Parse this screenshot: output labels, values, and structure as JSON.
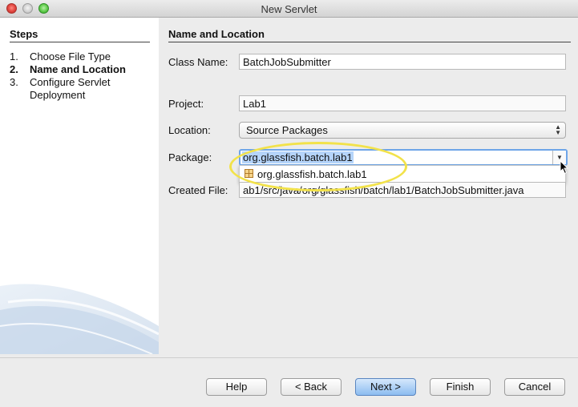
{
  "window": {
    "title": "New Servlet"
  },
  "steps": {
    "heading": "Steps",
    "items": [
      {
        "num": "1.",
        "label": "Choose File Type"
      },
      {
        "num": "2.",
        "label": "Name and Location"
      },
      {
        "num": "3.",
        "label": "Configure Servlet"
      },
      {
        "num": "",
        "label": "Deployment"
      }
    ]
  },
  "form": {
    "heading": "Name and Location",
    "class_name_label": "Class Name:",
    "class_name_value": "BatchJobSubmitter",
    "project_label": "Project:",
    "project_value": "Lab1",
    "location_label": "Location:",
    "location_value": "Source Packages",
    "package_label": "Package:",
    "package_value": "org.glassfish.batch.lab1",
    "package_suggestion": "org.glassfish.batch.lab1",
    "created_file_label": "Created File:",
    "created_file_value": "ab1/src/java/org/glassfish/batch/lab1/BatchJobSubmitter.java"
  },
  "buttons": {
    "help": "Help",
    "back": "< Back",
    "next": "Next >",
    "finish": "Finish",
    "cancel": "Cancel"
  },
  "colors": {
    "accent": "#6ea5e8",
    "highlight_ring": "#f2e24a",
    "selection": "#b5d4fa"
  }
}
